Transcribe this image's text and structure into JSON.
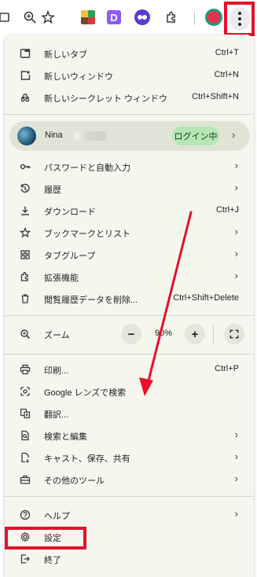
{
  "toolbar": {
    "icons": [
      "tab-stack-icon",
      "zoom-icon",
      "star-icon",
      "extension-multicolor-icon",
      "extension-d-icon",
      "extension-face-icon",
      "puzzle-icon",
      "profile-icon",
      "more-vert-icon"
    ],
    "ext_d_label": "D"
  },
  "menu": {
    "new_tab": {
      "label": "新しいタブ",
      "shortcut": "Ctrl+T"
    },
    "new_window": {
      "label": "新しいウィンドウ",
      "shortcut": "Ctrl+N"
    },
    "incognito": {
      "label": "新しいシークレット ウィンドウ",
      "shortcut": "Ctrl+Shift+N"
    },
    "profile": {
      "name": "Nina",
      "status": "ログイン中"
    },
    "passwords": {
      "label": "パスワードと自動入力"
    },
    "history": {
      "label": "履歴"
    },
    "downloads": {
      "label": "ダウンロード",
      "shortcut": "Ctrl+J"
    },
    "bookmarks": {
      "label": "ブックマークとリスト"
    },
    "tab_groups": {
      "label": "タブグループ"
    },
    "extensions": {
      "label": "拡張機能"
    },
    "clear_data": {
      "label": "閲覧履歴データを削除...",
      "shortcut": "Ctrl+Shift+Delete"
    },
    "zoom": {
      "label": "ズーム",
      "value": "90%",
      "minus": "−",
      "plus": "+"
    },
    "print": {
      "label": "印刷...",
      "shortcut": "Ctrl+P"
    },
    "lens": {
      "label": "Google レンズで検索"
    },
    "translate": {
      "label": "翻訳..."
    },
    "find_edit": {
      "label": "検索と編集"
    },
    "cast": {
      "label": "キャスト、保存、共有"
    },
    "more_tools": {
      "label": "その他のツール"
    },
    "help": {
      "label": "ヘルプ"
    },
    "settings": {
      "label": "設定"
    },
    "exit": {
      "label": "終了"
    }
  },
  "colors": {
    "highlight": "#e8102a",
    "menu_bg": "#f5f7ee",
    "badge_bg": "#b5e7b4"
  }
}
